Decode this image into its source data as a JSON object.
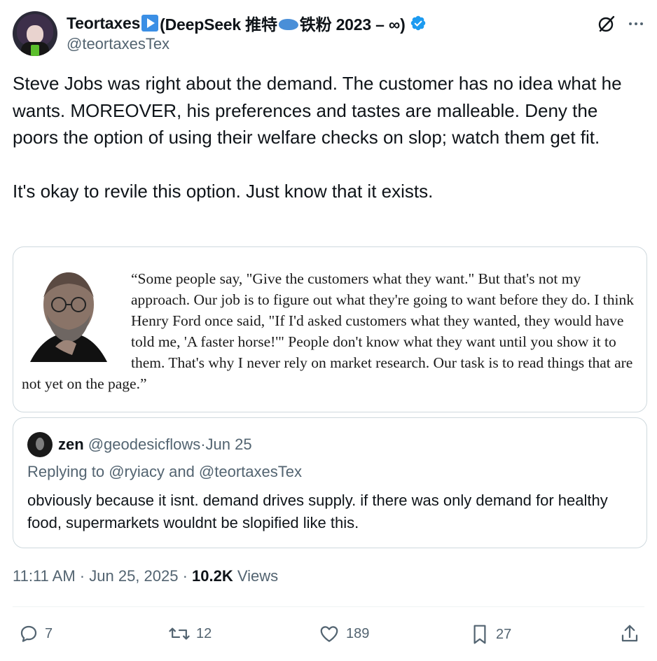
{
  "author": {
    "name_part1": "Teortaxes",
    "name_part2": " (DeepSeek 推特",
    "name_part3": "铁粉 2023 – ∞)",
    "handle": "@teortaxesTex"
  },
  "tweet": {
    "text": "Steve Jobs was right about the demand. The customer has no idea what he wants. MOREOVER, his preferences and tastes are malleable. Deny the poors the option of using their welfare checks on slop; watch them get fit.\n\nIt's okay to revile this option. Just know that it exists."
  },
  "media": {
    "quote": "“Some people say, \"Give the customers what they want.\" But that's not my approach. Our job is to figure out what they're going to want before they do. I think Henry Ford once said, \"If I'd asked customers what they wanted, they would have told me, 'A faster horse!'\" People don't know what they want until you show it to them. That's why I never rely on market research. Our task is to read things that are not yet on the page.”"
  },
  "quoted": {
    "name": "zen",
    "handle": "@geodesicflows",
    "separator": " · ",
    "date": "Jun 25",
    "replying_prefix": "Replying to ",
    "reply_to_1": "@ryiacy",
    "reply_and": " and ",
    "reply_to_2": "@teortaxesTex",
    "text": "obviously because it isnt. demand drives supply. if there was only demand for healthy food, supermarkets wouldnt be slopified like this."
  },
  "meta": {
    "time": "11:11 AM",
    "separator": " · ",
    "date": "Jun 25, 2025",
    "views_count": "10.2K",
    "views_label": " Views"
  },
  "actions": {
    "replies": "7",
    "reposts": "12",
    "likes": "189",
    "bookmarks": "27"
  },
  "colors": {
    "text": "#0f1419",
    "secondary": "#536471",
    "verified": "#1d9bf0",
    "border": "#cfd9de"
  }
}
